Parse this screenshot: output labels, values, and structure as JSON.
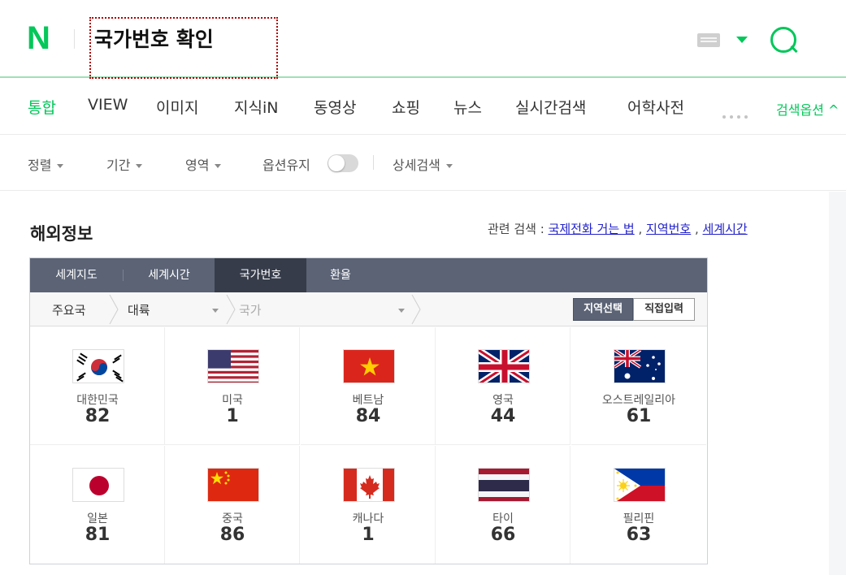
{
  "header": {
    "logo_text": "N",
    "search_value": "국가번호 확인"
  },
  "tabs": [
    {
      "label": "통합"
    },
    {
      "label": "VIEW"
    },
    {
      "label": "이미지"
    },
    {
      "label": "지식iN"
    },
    {
      "label": "동영상"
    },
    {
      "label": "쇼핑"
    },
    {
      "label": "뉴스"
    },
    {
      "label": "실시간검색"
    },
    {
      "label": "어학사전"
    }
  ],
  "search_options_label": "검색옵션 ^",
  "filters": {
    "sort": "정렬",
    "period": "기간",
    "area": "영역",
    "keep_options": "옵션유지",
    "detail": "상세검색"
  },
  "section": {
    "title": "해외정보",
    "related_label": "관련 검색 : ",
    "related_links": [
      "국제전화 거는 법",
      "지역번호",
      "세계시간"
    ]
  },
  "widget": {
    "tabs": [
      {
        "label": "세계지도"
      },
      {
        "label": "세계시간"
      },
      {
        "label": "국가번호"
      },
      {
        "label": "환율"
      }
    ],
    "selector": {
      "major": "주요국",
      "continent": "대륙",
      "country": "국가",
      "region_button": "지역선택",
      "direct_button": "직접입력"
    },
    "countries": [
      {
        "name": "대한민국",
        "code": "82",
        "flag": "korea-flag-icon"
      },
      {
        "name": "미국",
        "code": "1",
        "flag": "usa-flag-icon"
      },
      {
        "name": "베트남",
        "code": "84",
        "flag": "vietnam-flag-icon"
      },
      {
        "name": "영국",
        "code": "44",
        "flag": "uk-flag-icon"
      },
      {
        "name": "오스트레일리아",
        "code": "61",
        "flag": "australia-flag-icon"
      },
      {
        "name": "일본",
        "code": "81",
        "flag": "japan-flag-icon"
      },
      {
        "name": "중국",
        "code": "86",
        "flag": "china-flag-icon"
      },
      {
        "name": "캐나다",
        "code": "1",
        "flag": "canada-flag-icon"
      },
      {
        "name": "타이",
        "code": "66",
        "flag": "thailand-flag-icon"
      },
      {
        "name": "필리핀",
        "code": "63",
        "flag": "philippines-flag-icon"
      }
    ]
  },
  "colors": {
    "brand_green": "#03c75a",
    "tab_bar": "#5b6375",
    "tab_active": "#363c4a",
    "link_blue": "#2222cc"
  }
}
